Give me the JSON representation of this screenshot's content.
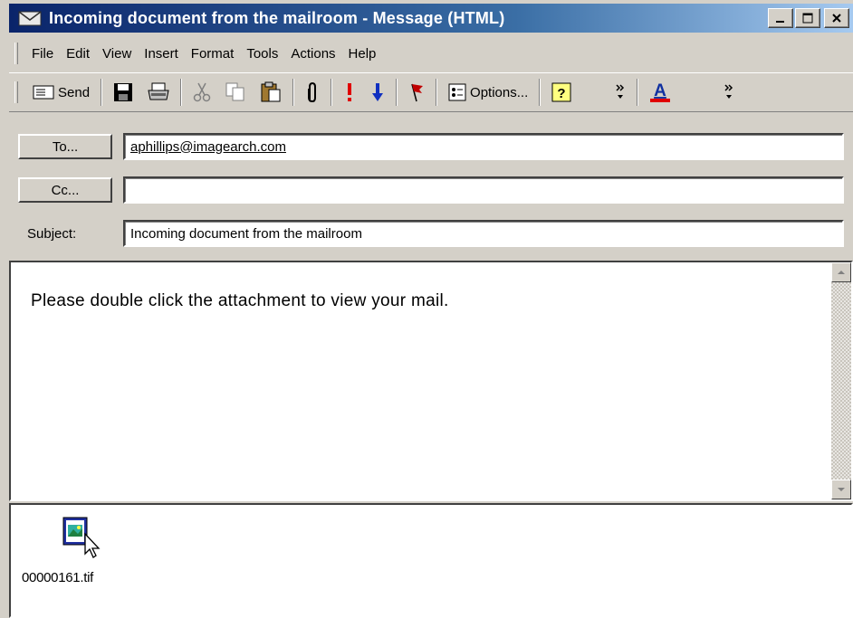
{
  "window": {
    "title": "Incoming document from the mailroom - Message (HTML)"
  },
  "menu": [
    "File",
    "Edit",
    "View",
    "Insert",
    "Format",
    "Tools",
    "Actions",
    "Help"
  ],
  "toolbar": {
    "send_label": "Send",
    "options_label": "Options..."
  },
  "fields": {
    "to_label": "To...",
    "to_value": "aphillips@imagearch.com",
    "cc_label": "Cc...",
    "cc_value": "",
    "subject_label": "Subject:",
    "subject_value": "Incoming document from the mailroom"
  },
  "body": {
    "text": "Please double click the attachment to view your mail."
  },
  "attachment": {
    "filename": "00000161.tif"
  },
  "colors": {
    "titlebar_start": "#0a246a",
    "titlebar_end": "#a6caf0",
    "importance_high": "#e00000",
    "importance_low": "#1030c0",
    "font_color_bar": "#e00000"
  }
}
